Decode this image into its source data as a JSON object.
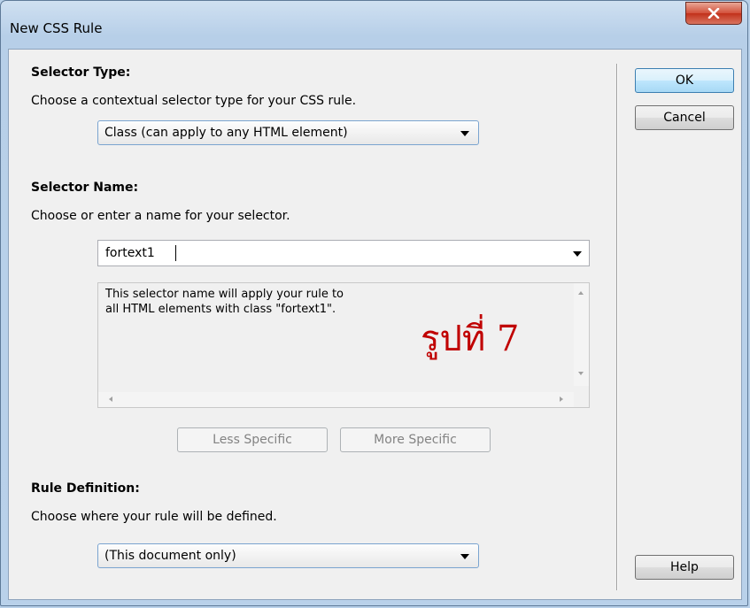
{
  "window": {
    "title": "New CSS Rule"
  },
  "selector_type": {
    "heading": "Selector Type:",
    "description": "Choose a contextual selector type for your CSS rule.",
    "selected": "Class (can apply to any HTML element)"
  },
  "selector_name": {
    "heading": "Selector Name:",
    "description": "Choose or enter a name for your selector.",
    "value": "fortext1",
    "info_line1": "This selector name will apply your rule to",
    "info_line2": "all HTML elements with class \"fortext1\".",
    "annotation": "รูปที่ 7",
    "less_specific_label": "Less Specific",
    "more_specific_label": "More Specific"
  },
  "rule_definition": {
    "heading": "Rule Definition:",
    "description": "Choose where your rule will be defined.",
    "selected": "(This document only)"
  },
  "buttons": {
    "ok": "OK",
    "cancel": "Cancel",
    "help": "Help"
  },
  "colors": {
    "annotation": "#c00000",
    "close_button": "#c2311b",
    "default_button_border": "#3c7fb1"
  },
  "icons": {
    "close": "close-x-icon",
    "dropdown": "chevron-down-icon"
  }
}
